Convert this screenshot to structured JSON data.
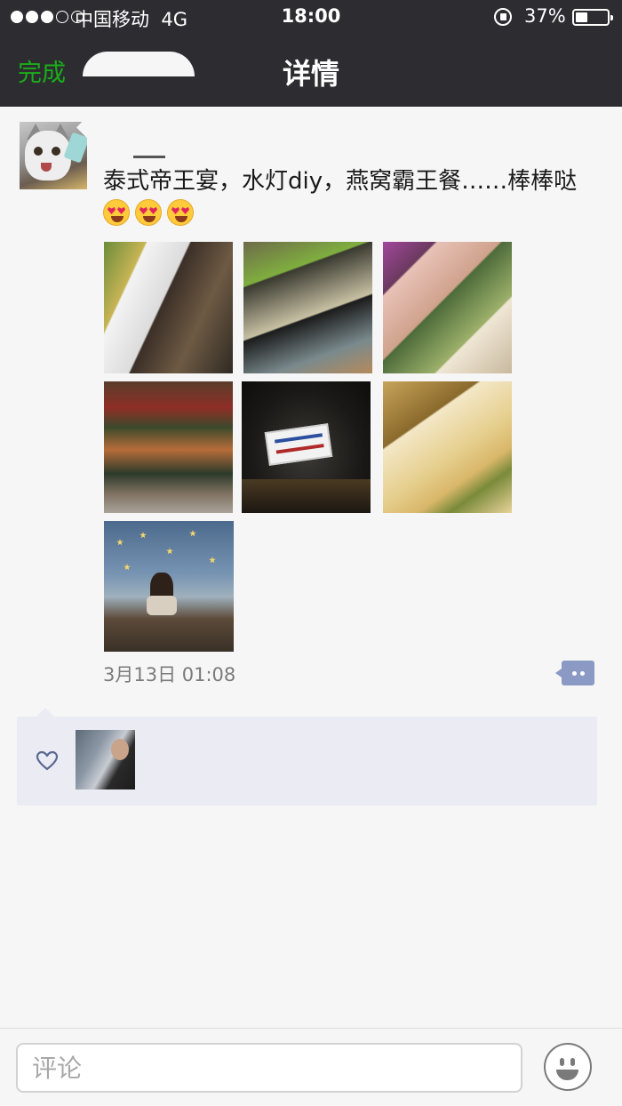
{
  "status_bar": {
    "signal_dots_filled": 3,
    "signal_dots_total": 5,
    "carrier": "中国移动",
    "network": "4G",
    "time": "18:00",
    "battery": "37%",
    "battery_level": 0.37
  },
  "nav": {
    "done_label": "完成",
    "title": "详情",
    "accent_color": "#1aad19"
  },
  "post": {
    "avatar_icon": "cat-avatar",
    "text": "泰式帝王宴，水灯diy，燕窝霸王餐……棒棒哒",
    "emoji": "heart-eyes-emoji",
    "emoji_count": 3,
    "photo_count": 7,
    "time": "3月13日 01:08",
    "comment_icon": "comment-dots-icon"
  },
  "likes": {
    "icon": "heart-icon",
    "liker_count": 1
  },
  "comment_bar": {
    "placeholder": "评论",
    "emoji_icon": "smiley-icon"
  }
}
